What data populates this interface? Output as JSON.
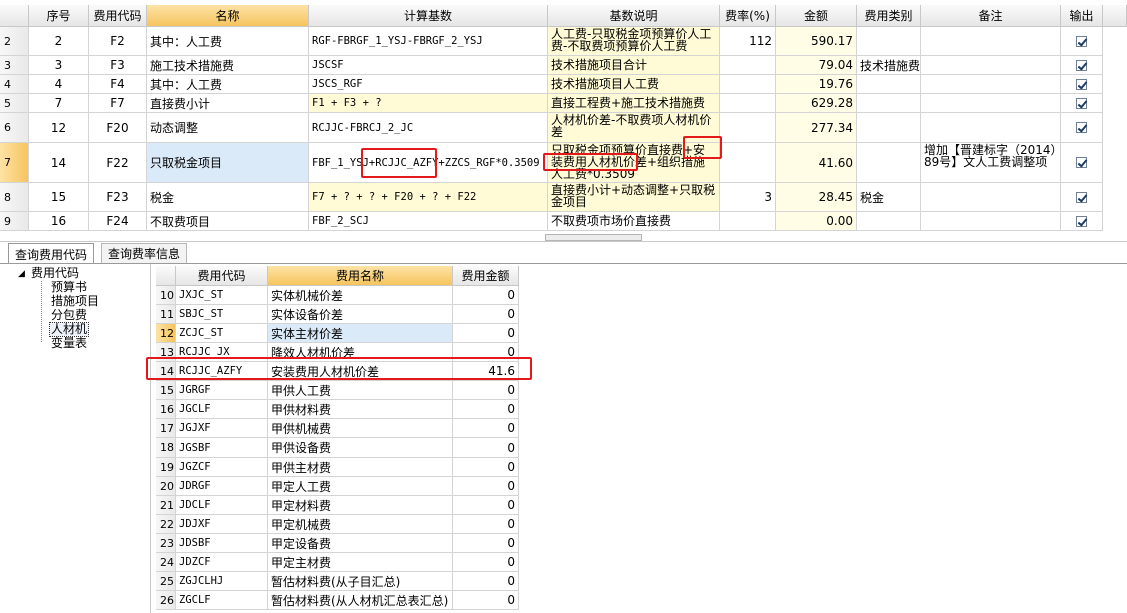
{
  "main_table": {
    "columns": [
      "序号",
      "费用代码",
      "名称",
      "计算基数",
      "基数说明",
      "费率(%)",
      "金额",
      "费用类别",
      "备注",
      "输出"
    ],
    "rows": [
      {
        "row": "2",
        "seq": "2",
        "code": "F2",
        "name": "其中：人工费",
        "base": "RGF-FBRGF_1_YSJ-FBRGF_2_YSJ",
        "desc": "人工费-只取税金项预算价人工费-不取费项预算价人工费",
        "rate": "112",
        "amount": "590.17",
        "category": "",
        "note": ""
      },
      {
        "row": "3",
        "seq": "3",
        "code": "F3",
        "name": "施工技术措施费",
        "base": "JSCSF",
        "desc": "技术措施项目合计",
        "rate": "",
        "amount": "79.04",
        "category": "技术措施费",
        "note": ""
      },
      {
        "row": "4",
        "seq": "4",
        "code": "F4",
        "name": "其中：人工费",
        "base": "JSCS_RGF",
        "desc": "技术措施项目人工费",
        "rate": "",
        "amount": "19.76",
        "category": "",
        "note": ""
      },
      {
        "row": "5",
        "seq": "7",
        "code": "F7",
        "name": "直接费小计",
        "base": "F1 + F3 + ?",
        "desc": "直接工程费+施工技术措施费",
        "rate": "",
        "amount": "629.28",
        "category": "",
        "note": ""
      },
      {
        "row": "6",
        "seq": "12",
        "code": "F20",
        "name": "动态调整",
        "base": "RCJJC-FBRCJ_2_JC",
        "desc": "人材机价差-不取费项人材机价差",
        "rate": "",
        "amount": "277.34",
        "category": "",
        "note": ""
      },
      {
        "row": "7",
        "seq": "14",
        "code": "F22",
        "name": "只取税金项目",
        "base": "FBF_1_YSJ+RCJJC_AZFY+ZZCS_RGF*0.3509",
        "desc": "只取税金项预算价直接费+安装费用人材机价差+组织措施人工费*0.3509",
        "rate": "",
        "amount": "41.60",
        "category": "",
        "note": "增加【晋建标字（2014）89号】文人工费调整项"
      },
      {
        "row": "8",
        "seq": "15",
        "code": "F23",
        "name": "税金",
        "base": "F7 + ? + ? + F20 + ? + F22",
        "desc": "直接费小计+动态调整+只取税金项目",
        "rate": "3",
        "amount": "28.45",
        "category": "税金",
        "note": ""
      },
      {
        "row": "9",
        "seq": "16",
        "code": "F24",
        "name": "不取费项目",
        "base": "FBF_2_SCJ",
        "desc": "不取费项市场价直接费",
        "rate": "",
        "amount": "0.00",
        "category": "",
        "note": ""
      }
    ]
  },
  "tabs": [
    "查询费用代码",
    "查询费率信息"
  ],
  "tree": {
    "root": "费用代码",
    "children": [
      "预算书",
      "措施项目",
      "分包费",
      "人材机",
      "变量表"
    ]
  },
  "code_table": {
    "columns": [
      "费用代码",
      "费用名称",
      "费用金额"
    ],
    "rows": [
      {
        "row": "10",
        "code": "JXJC_ST",
        "name": "实体机械价差",
        "amount": "0"
      },
      {
        "row": "11",
        "code": "SBJC_ST",
        "name": "实体设备价差",
        "amount": "0"
      },
      {
        "row": "12",
        "code": "ZCJC_ST",
        "name": "实体主材价差",
        "amount": "0"
      },
      {
        "row": "13",
        "code": "RCJJC_JX",
        "name": "降效人材机价差",
        "amount": "0"
      },
      {
        "row": "14",
        "code": "RCJJC_AZFY",
        "name": "安装费用人材机价差",
        "amount": "41.6"
      },
      {
        "row": "15",
        "code": "JGRGF",
        "name": "甲供人工费",
        "amount": "0"
      },
      {
        "row": "16",
        "code": "JGCLF",
        "name": "甲供材料费",
        "amount": "0"
      },
      {
        "row": "17",
        "code": "JGJXF",
        "name": "甲供机械费",
        "amount": "0"
      },
      {
        "row": "18",
        "code": "JGSBF",
        "name": "甲供设备费",
        "amount": "0"
      },
      {
        "row": "19",
        "code": "JGZCF",
        "name": "甲供主材费",
        "amount": "0"
      },
      {
        "row": "20",
        "code": "JDRGF",
        "name": "甲定人工费",
        "amount": "0"
      },
      {
        "row": "21",
        "code": "JDCLF",
        "name": "甲定材料费",
        "amount": "0"
      },
      {
        "row": "22",
        "code": "JDJXF",
        "name": "甲定机械费",
        "amount": "0"
      },
      {
        "row": "23",
        "code": "JDSBF",
        "name": "甲定设备费",
        "amount": "0"
      },
      {
        "row": "24",
        "code": "JDZCF",
        "name": "甲定主材费",
        "amount": "0"
      },
      {
        "row": "25",
        "code": "ZGJCLHJ",
        "name": "暂估材料费(从子目汇总)",
        "amount": "0"
      },
      {
        "row": "26",
        "code": "ZGCLF",
        "name": "暂估材料费(从人材机汇总表汇总)",
        "amount": "0"
      }
    ]
  },
  "colors": {
    "highlight": "#e3191c",
    "selected_header": "#f6c45e",
    "yellow_cell": "#fffbd6",
    "blue_cell": "#dbeaf9"
  }
}
